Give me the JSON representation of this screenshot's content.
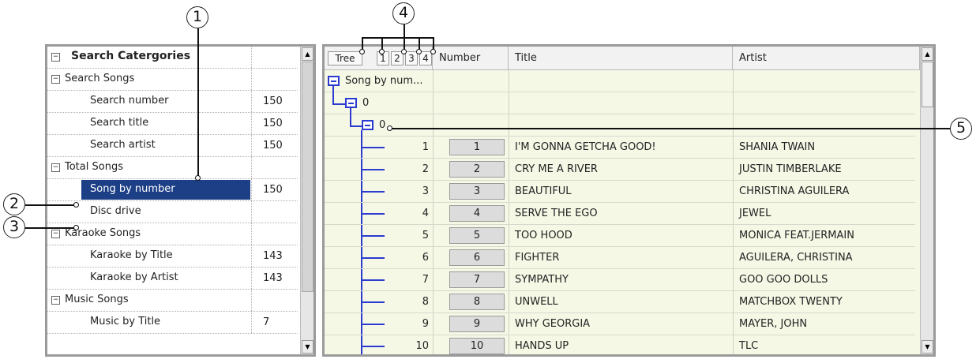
{
  "categories": {
    "header": "Search Catergories",
    "rows": [
      {
        "label": "Search Songs",
        "count": "",
        "level": 0,
        "expander": "−"
      },
      {
        "label": "Search number",
        "count": "150",
        "level": 1
      },
      {
        "label": "Search title",
        "count": "150",
        "level": 1
      },
      {
        "label": "Search artist",
        "count": "150",
        "level": 1
      },
      {
        "label": "Total Songs",
        "count": "",
        "level": 0,
        "expander": "−"
      },
      {
        "label": "Song by number",
        "count": "150",
        "level": 1,
        "selected": true
      },
      {
        "label": "Disc drive",
        "count": "",
        "level": 1
      },
      {
        "label": "Karaoke Songs",
        "count": "",
        "level": 0,
        "expander": "−"
      },
      {
        "label": "Karaoke by Title",
        "count": "143",
        "level": 1
      },
      {
        "label": "Karaoke by Artist",
        "count": "143",
        "level": 1
      },
      {
        "label": "Music Songs",
        "count": "",
        "level": 0,
        "expander": "−"
      },
      {
        "label": "Music by Title",
        "count": "7",
        "level": 1
      }
    ]
  },
  "songs": {
    "columns": {
      "tree": "Tree",
      "levels": [
        "1",
        "2",
        "3",
        "4"
      ],
      "number": "Number",
      "title": "Title",
      "artist": "Artist"
    },
    "tree_root": "Song by num...",
    "tree_level1": "0",
    "tree_level2": "0",
    "rows": [
      {
        "index": "1",
        "number": "1",
        "title": "I'M GONNA GETCHA GOOD!",
        "artist": "SHANIA TWAIN"
      },
      {
        "index": "2",
        "number": "2",
        "title": "CRY ME A RIVER",
        "artist": "JUSTIN TIMBERLAKE"
      },
      {
        "index": "3",
        "number": "3",
        "title": "BEAUTIFUL",
        "artist": "CHRISTINA AGUILERA"
      },
      {
        "index": "4",
        "number": "4",
        "title": "SERVE THE EGO",
        "artist": "JEWEL"
      },
      {
        "index": "5",
        "number": "5",
        "title": "TOO HOOD",
        "artist": "MONICA FEAT.JERMAIN"
      },
      {
        "index": "6",
        "number": "6",
        "title": "FIGHTER",
        "artist": "AGUILERA, CHRISTINA"
      },
      {
        "index": "7",
        "number": "7",
        "title": "SYMPATHY",
        "artist": "GOO GOO DOLLS"
      },
      {
        "index": "8",
        "number": "8",
        "title": "UNWELL",
        "artist": "MATCHBOX TWENTY"
      },
      {
        "index": "9",
        "number": "9",
        "title": "WHY GEORGIA",
        "artist": "MAYER, JOHN"
      },
      {
        "index": "10",
        "number": "10",
        "title": "HANDS UP",
        "artist": "TLC"
      }
    ]
  },
  "callouts": [
    "1",
    "2",
    "3",
    "4",
    "5"
  ],
  "icons": {
    "collapse": "minus-box-icon",
    "scroll_up": "up-arrow-icon",
    "scroll_down": "down-arrow-icon"
  },
  "colors": {
    "selection": "#1c3f86",
    "tree_lines": "#2b3bd0",
    "grid_background": "#f6f8e6"
  }
}
